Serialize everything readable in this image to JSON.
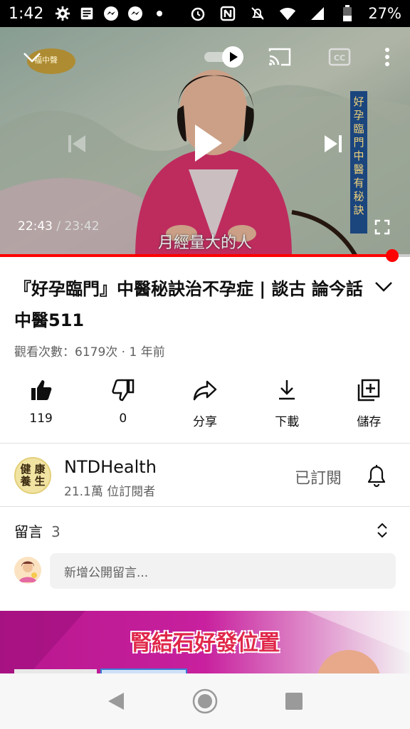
{
  "status_bar": {
    "time": "1:42",
    "battery": "27%"
  },
  "player": {
    "current_time": "22:43",
    "separator": " / ",
    "duration": "23:42",
    "subtitle": "月經量大的人",
    "progress_fraction": 0.957,
    "logo_text": "福中聲",
    "banner_text": "好孕臨門中醫有秘訣"
  },
  "video": {
    "title": "『好孕臨門』中醫秘訣治不孕症 | 談古 論今話中醫511",
    "views": "觀看次數：6179次 · 1 年前"
  },
  "actions": [
    {
      "id": "like",
      "label": "119"
    },
    {
      "id": "dislike",
      "label": "0"
    },
    {
      "id": "share",
      "label": "分享"
    },
    {
      "id": "download",
      "label": "下載"
    },
    {
      "id": "save",
      "label": "儲存"
    }
  ],
  "channel": {
    "avatar_chars": [
      "健",
      "康",
      "養",
      "生"
    ],
    "name": "NTDHealth",
    "subscribers": "21.1萬 位訂閱者",
    "subscribe_state": "已訂閱"
  },
  "comments": {
    "label": "留言",
    "count": "3",
    "placeholder": "新增公開留言..."
  },
  "next_video": {
    "thumbnail_text": "腎結石好發位置"
  },
  "colors": {
    "accent": "#ff0000",
    "secondary_text": "#606060"
  }
}
